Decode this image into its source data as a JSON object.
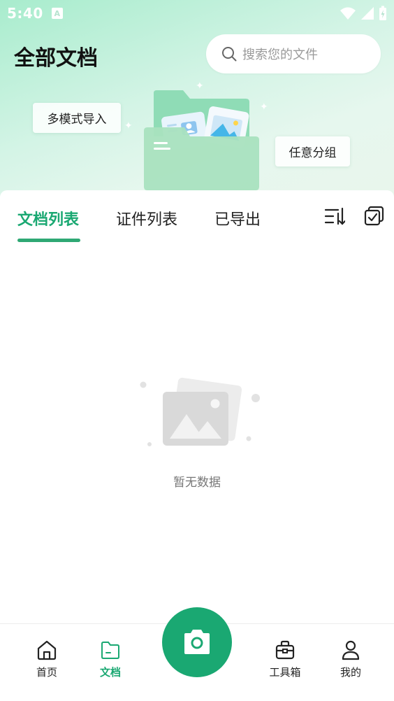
{
  "status_bar": {
    "time": "5:40",
    "notification_badge": "A"
  },
  "header": {
    "title": "全部文档",
    "search_placeholder": "搜索您的文件"
  },
  "hero": {
    "import_chip": "多模式导入",
    "group_chip": "任意分组"
  },
  "tabs": [
    {
      "label": "文档列表",
      "active": true
    },
    {
      "label": "证件列表",
      "active": false
    },
    {
      "label": "已导出",
      "active": false
    }
  ],
  "toolbar_icons": [
    "sort-icon",
    "multi-select-icon"
  ],
  "empty_state": {
    "text": "暂无数据"
  },
  "bottom_nav": {
    "items": [
      {
        "label": "首页",
        "icon": "home-icon",
        "active": false
      },
      {
        "label": "文档",
        "icon": "folder-icon",
        "active": true
      },
      {
        "label": "工具箱",
        "icon": "toolbox-icon",
        "active": false
      },
      {
        "label": "我的",
        "icon": "user-icon",
        "active": false
      }
    ],
    "camera_icon": "camera-icon"
  },
  "colors": {
    "accent": "#1aa872",
    "hero_gradient_start": "#a8eccd",
    "hero_gradient_end": "#e9f6ec"
  }
}
